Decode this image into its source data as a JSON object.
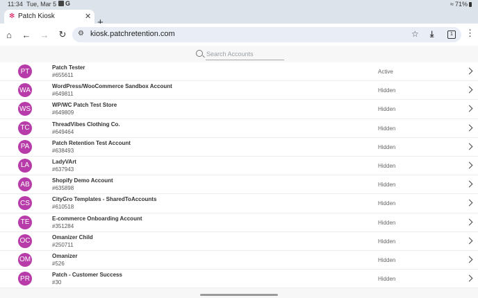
{
  "status_bar": {
    "time": "11:34",
    "date": "Tue, Mar 5",
    "battery": "71%"
  },
  "tab": {
    "title": "Patch Kiosk"
  },
  "toolbar": {
    "url": "kiosk.patchretention.com",
    "tab_count": "1"
  },
  "search": {
    "placeholder": "Search Accounts",
    "value": ""
  },
  "accounts": [
    {
      "initials": "PT",
      "name": "Patch Tester",
      "id": "#655611",
      "status": "Active"
    },
    {
      "initials": "WA",
      "name": "WordPress/WooCommerce Sandbox Account",
      "id": "#649811",
      "status": "Hidden"
    },
    {
      "initials": "WS",
      "name": "WP/WC Patch Test Store",
      "id": "#649809",
      "status": "Hidden"
    },
    {
      "initials": "TC",
      "name": "ThreadVibes Clothing Co.",
      "id": "#649464",
      "status": "Hidden"
    },
    {
      "initials": "PA",
      "name": "Patch Retention Test Account",
      "id": "#638493",
      "status": "Hidden"
    },
    {
      "initials": "LA",
      "name": "LadyVArt",
      "id": "#637943",
      "status": "Hidden"
    },
    {
      "initials": "AB",
      "name": "Shopify Demo Account",
      "id": "#635898",
      "status": "Hidden"
    },
    {
      "initials": "CS",
      "name": "CityGro Templates - SharedToAccounts",
      "id": "#610518",
      "status": "Hidden"
    },
    {
      "initials": "TE",
      "name": "E-commerce Onboarding Account",
      "id": "#351284",
      "status": "Hidden"
    },
    {
      "initials": "OC",
      "name": "Omanizer Child",
      "id": "#250711",
      "status": "Hidden"
    },
    {
      "initials": "OM",
      "name": "Omanizer",
      "id": "#526",
      "status": "Hidden"
    },
    {
      "initials": "PR",
      "name": "Patch - Customer Success",
      "id": "#30",
      "status": "Hidden"
    }
  ],
  "colors": {
    "avatar": "#b73ba8",
    "omnibox": "#e9eef6",
    "chrome": "#dde3ea"
  }
}
